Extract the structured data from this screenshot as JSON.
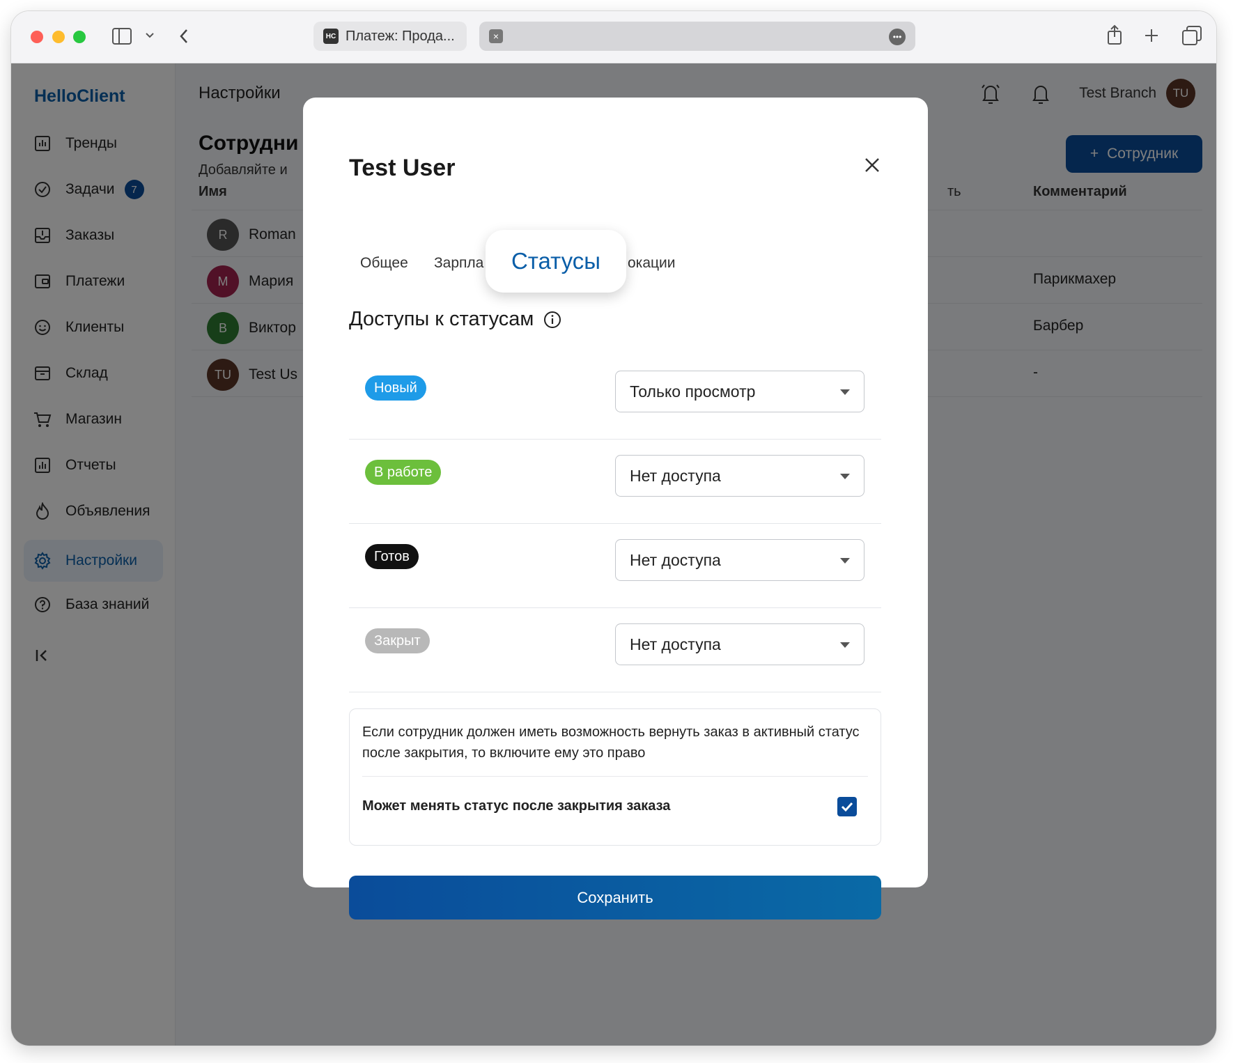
{
  "browser": {
    "tab_title": "Платеж: Прода...",
    "tab_favicon": "HC"
  },
  "sidebar": {
    "brand": "HelloClient",
    "items": [
      {
        "label": "Тренды",
        "icon": "chart-icon"
      },
      {
        "label": "Задачи",
        "icon": "check-circle-icon",
        "badge": "7"
      },
      {
        "label": "Заказы",
        "icon": "inbox-icon"
      },
      {
        "label": "Платежи",
        "icon": "wallet-icon"
      },
      {
        "label": "Клиенты",
        "icon": "smile-icon"
      },
      {
        "label": "Склад",
        "icon": "archive-icon"
      },
      {
        "label": "Магазин",
        "icon": "cart-icon"
      },
      {
        "label": "Отчеты",
        "icon": "report-icon"
      },
      {
        "label": "Объявления",
        "icon": "fire-icon"
      },
      {
        "label": "Настройки",
        "icon": "gear-icon",
        "active": true
      },
      {
        "label": "База знаний",
        "icon": "help-icon"
      }
    ]
  },
  "header": {
    "title": "Настройки",
    "branch": "Test Branch",
    "avatar": "TU"
  },
  "content": {
    "section_title": "Сотрудни",
    "section_sub": "Добавляйте и",
    "add_button": "Сотрудник",
    "col_name": "Имя",
    "col_partial": "ть",
    "col_comment": "Комментарий",
    "rows": [
      {
        "initial": "R",
        "name": "Roman",
        "comment": "",
        "color": "#555555"
      },
      {
        "initial": "M",
        "name": "Мария",
        "comment": "Парикмахер",
        "color": "#a3224f"
      },
      {
        "initial": "B",
        "name": "Виктор",
        "comment": "Барбер",
        "color": "#2e7d32"
      },
      {
        "initial": "TU",
        "name": "Test Us",
        "comment": "-",
        "color": "#5a3526"
      }
    ]
  },
  "modal": {
    "title": "Test User",
    "tabs": {
      "general": "Общее",
      "salary": "Зарпла",
      "statuses": "Статусы",
      "locations": "окации"
    },
    "perm_title": "Доступы к статусам",
    "statuses": [
      {
        "label": "Новый",
        "color": "#1e9be8",
        "access": "Только просмотр"
      },
      {
        "label": "В работе",
        "color": "#6cbf3c",
        "access": "Нет доступа"
      },
      {
        "label": "Готов",
        "color": "#111111",
        "access": "Нет доступа"
      },
      {
        "label": "Закрыт",
        "color": "#b8b8b8",
        "access": "Нет доступа"
      }
    ],
    "note": "Если сотрудник должен иметь возможность вернуть заказ в активный статус после закрытия, то включите ему это право",
    "checkbox_label": "Может менять статус после закрытия заказа",
    "checkbox_checked": true,
    "save": "Сохранить"
  }
}
